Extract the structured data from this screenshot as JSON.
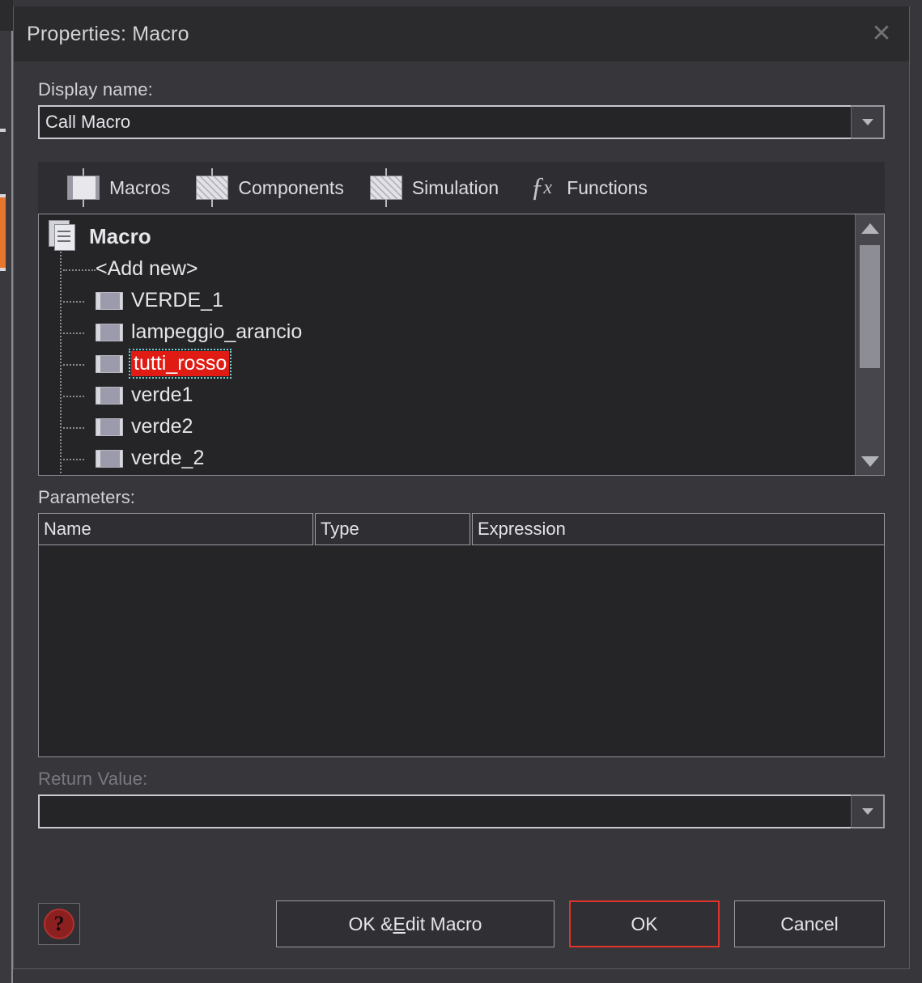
{
  "background": {
    "accent_color": "#e8762c"
  },
  "dialog": {
    "title": "Properties: Macro",
    "close_icon": "close-icon",
    "display_name": {
      "label": "Display name:",
      "value": "Call Macro",
      "placeholder": "",
      "dropdown_icon": "chevron-down-icon"
    },
    "tabs": [
      {
        "label": "Macros",
        "icon": "component-symbol-icon",
        "selected": true
      },
      {
        "label": "Components",
        "icon": "component-hatched-icon",
        "selected": false
      },
      {
        "label": "Simulation",
        "icon": "component-hatched-icon",
        "selected": false
      },
      {
        "label": "Functions",
        "icon": "fx-icon",
        "selected": false
      }
    ],
    "tree": {
      "root": {
        "label": "Macro",
        "icon": "documents-icon"
      },
      "items": [
        {
          "label": "<Add new>",
          "icon": "dashed-line-icon",
          "selected": false
        },
        {
          "label": "VERDE_1",
          "icon": "macro-node-icon",
          "selected": false
        },
        {
          "label": "lampeggio_arancio",
          "icon": "macro-node-icon",
          "selected": false
        },
        {
          "label": "tutti_rosso",
          "icon": "macro-node-icon",
          "selected": true
        },
        {
          "label": "verde1",
          "icon": "macro-node-icon",
          "selected": false
        },
        {
          "label": "verde2",
          "icon": "macro-node-icon",
          "selected": false
        },
        {
          "label": "verde_2",
          "icon": "macro-node-icon",
          "selected": false
        }
      ],
      "selection_color": "#e01b14",
      "scrollbar": {
        "up_icon": "scroll-up-arrow-icon",
        "down_icon": "scroll-down-arrow-icon"
      }
    },
    "parameters": {
      "label": "Parameters:",
      "columns": [
        "Name",
        "Type",
        "Expression"
      ],
      "rows": []
    },
    "return_value": {
      "label": "Return Value:",
      "value": "",
      "disabled": true,
      "dropdown_icon": "chevron-down-icon"
    },
    "footer": {
      "help_icon": "help-question-icon",
      "buttons": [
        {
          "name": "ok-edit-macro",
          "prefix": "OK & ",
          "accel": "E",
          "suffix": "dit Macro",
          "default": false
        },
        {
          "name": "ok",
          "label": "OK",
          "default": true
        },
        {
          "name": "cancel",
          "label": "Cancel",
          "default": false
        }
      ]
    }
  }
}
